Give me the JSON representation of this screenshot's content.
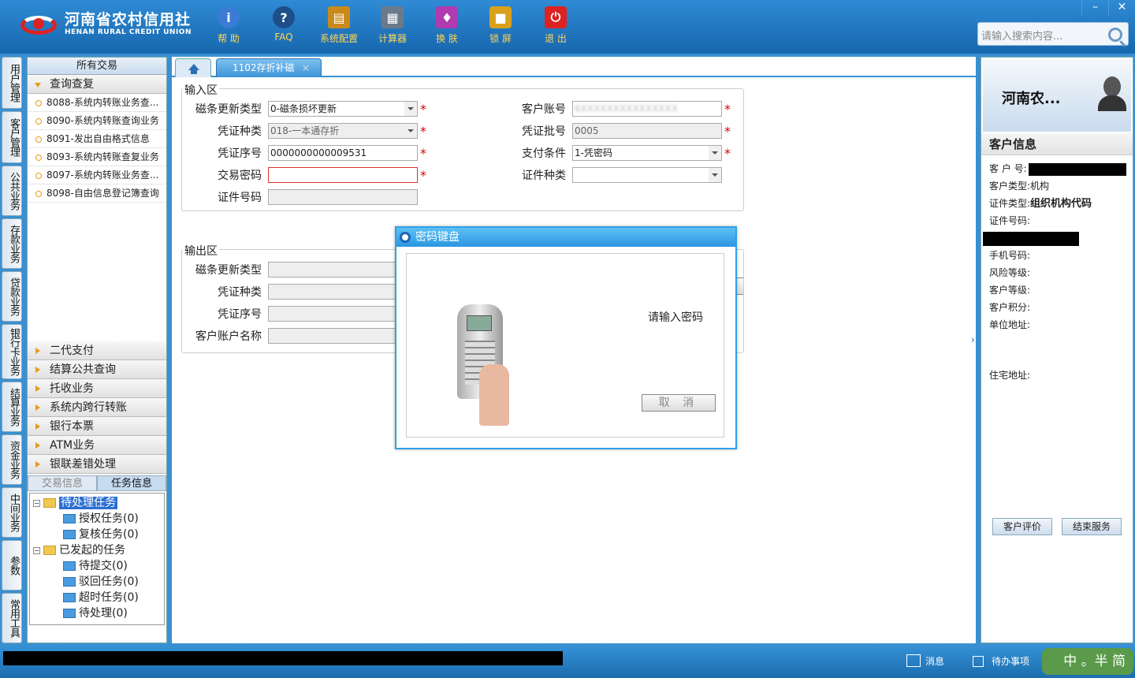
{
  "app": {
    "logo_cn": "河南省农村信用社",
    "logo_en": "HENAN RURAL CREDIT UNION"
  },
  "toolbar": [
    {
      "label": "帮 助",
      "icon": "info-icon",
      "color": "#3a7bd5"
    },
    {
      "label": "FAQ",
      "icon": "question-icon",
      "color": "#1d4e8a"
    },
    {
      "label": "系统配置",
      "icon": "toolbox-icon",
      "color": "#c98a1a"
    },
    {
      "label": "计算器",
      "icon": "calculator-icon",
      "color": "#6b7a8a"
    },
    {
      "label": "换 肤",
      "icon": "shirt-icon",
      "color": "#b03ab0"
    },
    {
      "label": "锁 屏",
      "icon": "lock-icon",
      "color": "#d9a11a"
    },
    {
      "label": "退 出",
      "icon": "power-icon",
      "color": "#d22"
    }
  ],
  "window_controls": [
    "–",
    "✕"
  ],
  "search": {
    "placeholder": "请输入搜索内容..."
  },
  "vertical_tabs": [
    "用户管理",
    "客户管理",
    "公共业务",
    "存款业务",
    "贷款业务",
    "银行卡业务",
    "结算业务",
    "资金业务",
    "中间业务",
    "参数",
    "常用工具"
  ],
  "left_panel": {
    "header": "所有交易",
    "open_group": "查询查复",
    "items": [
      "8088-系统内转账业务查...",
      "8090-系统内转账查询业务",
      "8091-发出自由格式信息",
      "8093-系统内转账查复业务",
      "8097-系统内转账业务查...",
      "8098-自由信息登记簿查询"
    ],
    "groups": [
      "二代支付",
      "结算公共查询",
      "托收业务",
      "系统内跨行转账",
      "银行本票",
      "ATM业务",
      "银联差错处理"
    ],
    "bottom_tabs": [
      "交易信息",
      "任务信息"
    ],
    "tree": {
      "pending": "待处理任务",
      "pending_children": [
        "授权任务(0)",
        "复核任务(0)"
      ],
      "started": "已发起的任务",
      "started_children": [
        "待提交(0)",
        "驳回任务(0)",
        "超时任务(0)",
        "待处理(0)"
      ]
    }
  },
  "tabs": {
    "active": "1102存折补磁",
    "close": "×"
  },
  "input_section": {
    "title": "输入区",
    "mag_update_type": {
      "label": "磁条更新类型",
      "value": "0-磁条损坏更新"
    },
    "voucher_type": {
      "label": "凭证种类",
      "value": "018-一本通存折"
    },
    "voucher_no": {
      "label": "凭证序号",
      "value": "0000000000009531"
    },
    "tx_password": {
      "label": "交易密码",
      "value": ""
    },
    "id_no": {
      "label": "证件号码",
      "value": ""
    },
    "account_no": {
      "label": "客户账号",
      "value": "6XXXXXXXXXXXXXXX"
    },
    "voucher_batch": {
      "label": "凭证批号",
      "value": "0005"
    },
    "pay_condition": {
      "label": "支付条件",
      "value": "1-凭密码"
    },
    "id_type": {
      "label": "证件种类",
      "value": ""
    },
    "required": "*"
  },
  "output_section": {
    "title": "输出区",
    "labels": [
      "磁条更新类型",
      "凭证种类",
      "凭证序号",
      "客户账户名称"
    ]
  },
  "dialog": {
    "title": "密码键盘",
    "message": "请输入密码",
    "cancel": "取 消"
  },
  "customer": {
    "name": "河南农...",
    "section_title": "客户信息",
    "fields": [
      {
        "label": "客 户 号:",
        "value": ""
      },
      {
        "label": "客户类型:",
        "value": "机构"
      },
      {
        "label": "证件类型:",
        "value": "组织机构代码"
      },
      {
        "label": "证件号码:",
        "value": ""
      },
      {
        "label": "手机号码:",
        "value": ""
      },
      {
        "label": "风险等级:",
        "value": ""
      },
      {
        "label": "客户等级:",
        "value": ""
      },
      {
        "label": "客户积分:",
        "value": ""
      },
      {
        "label": "单位地址:",
        "value": ""
      },
      {
        "label": "住宅地址:",
        "value": ""
      }
    ],
    "buttons": [
      "客户评价",
      "结束服务"
    ]
  },
  "status": {
    "message": "消息",
    "todo": "待办事项",
    "ime": "中 。半 简"
  }
}
